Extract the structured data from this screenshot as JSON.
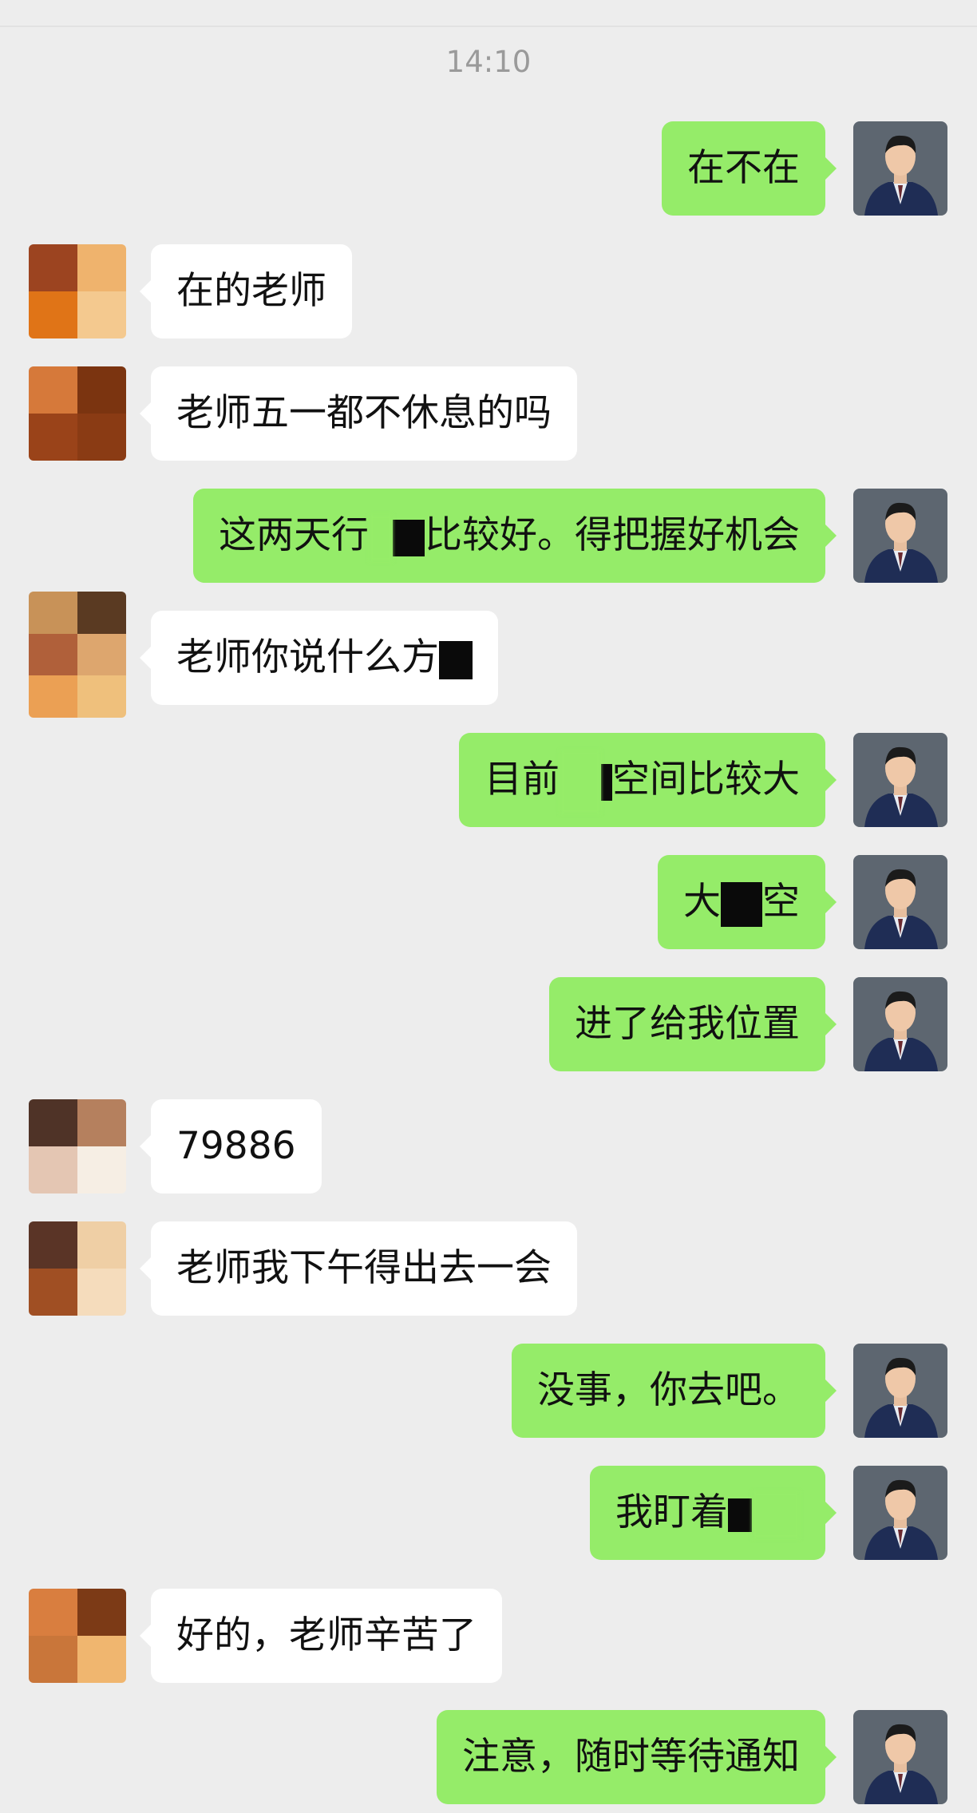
{
  "chat": {
    "timestamp": "14:10",
    "messages": [
      {
        "side": "right",
        "text": "在不在"
      },
      {
        "side": "left",
        "text": "在的老师"
      },
      {
        "side": "left",
        "text": "老师五一都不休息的吗"
      },
      {
        "side": "right",
        "text_before": "这两天行",
        "text_after": "比较好。得把握好机会"
      },
      {
        "side": "left",
        "text_before": "老师你说什么方",
        "text_after": ""
      },
      {
        "side": "right",
        "text_before": "目前",
        "text_after": "空间比较大"
      },
      {
        "side": "right",
        "text_before": "大",
        "text_after": "空"
      },
      {
        "side": "right",
        "text": "进了给我位置"
      },
      {
        "side": "left",
        "text": "79886"
      },
      {
        "side": "left",
        "text": "老师我下午得出去一会"
      },
      {
        "side": "right",
        "text": "没事，你去吧。"
      },
      {
        "side": "right",
        "text_before": "我盯着",
        "text_after": ""
      },
      {
        "side": "left",
        "text": "好的，老师辛苦了"
      },
      {
        "side": "right",
        "text": "注意，随时等待通知"
      }
    ]
  },
  "colors": {
    "sent_bubble": "#95ec69",
    "received_bubble": "#ffffff",
    "background": "#ededed"
  },
  "icons": {
    "self_avatar": "man-in-suit-avatar",
    "contact_avatar": "pixelated-avatar"
  }
}
